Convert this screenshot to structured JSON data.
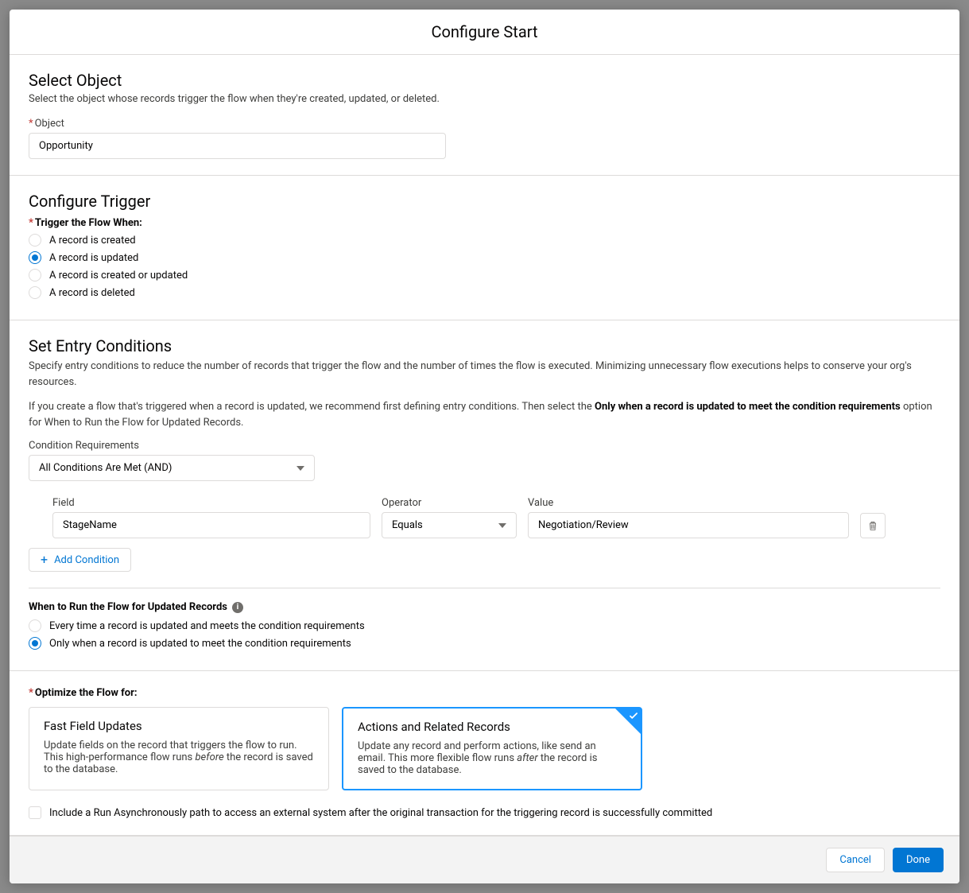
{
  "header": {
    "title": "Configure Start"
  },
  "selectObject": {
    "heading": "Select Object",
    "help": "Select the object whose records trigger the flow when they're created, updated, or deleted.",
    "label": "Object",
    "value": "Opportunity"
  },
  "configureTrigger": {
    "heading": "Configure Trigger",
    "label": "Trigger the Flow When:",
    "options": [
      "A record is created",
      "A record is updated",
      "A record is created or updated",
      "A record is deleted"
    ],
    "selectedIndex": 1
  },
  "entryConditions": {
    "heading": "Set Entry Conditions",
    "help1": "Specify entry conditions to reduce the number of records that trigger the flow and the number of times the flow is executed. Minimizing unnecessary flow executions helps to conserve your org's resources.",
    "help2_prefix": "If you create a flow that's triggered when a record is updated, we recommend first defining entry conditions. Then select the ",
    "help2_bold": "Only when a record is updated to meet the condition requirements",
    "help2_suffix": " option for When to Run the Flow for Updated Records.",
    "condReqLabel": "Condition Requirements",
    "condReqValue": "All Conditions Are Met (AND)",
    "columns": {
      "field": "Field",
      "operator": "Operator",
      "value": "Value"
    },
    "row": {
      "field": "StageName",
      "operator": "Equals",
      "value": "Negotiation/Review"
    },
    "addBtn": "Add Condition"
  },
  "whenRun": {
    "title": "When to Run the Flow for Updated Records",
    "options": [
      "Every time a record is updated and meets the condition requirements",
      "Only when a record is updated to meet the condition requirements"
    ],
    "selectedIndex": 1
  },
  "optimize": {
    "label": "Optimize the Flow for:",
    "cards": [
      {
        "title": "Fast Field Updates",
        "body_pre": "Update fields on the record that triggers the flow to run. This high-performance flow runs ",
        "body_italic": "before",
        "body_post": " the record is saved to the database."
      },
      {
        "title": "Actions and Related Records",
        "body_pre": "Update any record and perform actions, like send an email. This more flexible flow runs ",
        "body_italic": "after",
        "body_post": " the record is saved to the database."
      }
    ],
    "selectedIndex": 1,
    "asyncLabel": "Include a Run Asynchronously path to access an external system after the original transaction for the triggering record is successfully committed"
  },
  "footer": {
    "cancel": "Cancel",
    "done": "Done"
  }
}
